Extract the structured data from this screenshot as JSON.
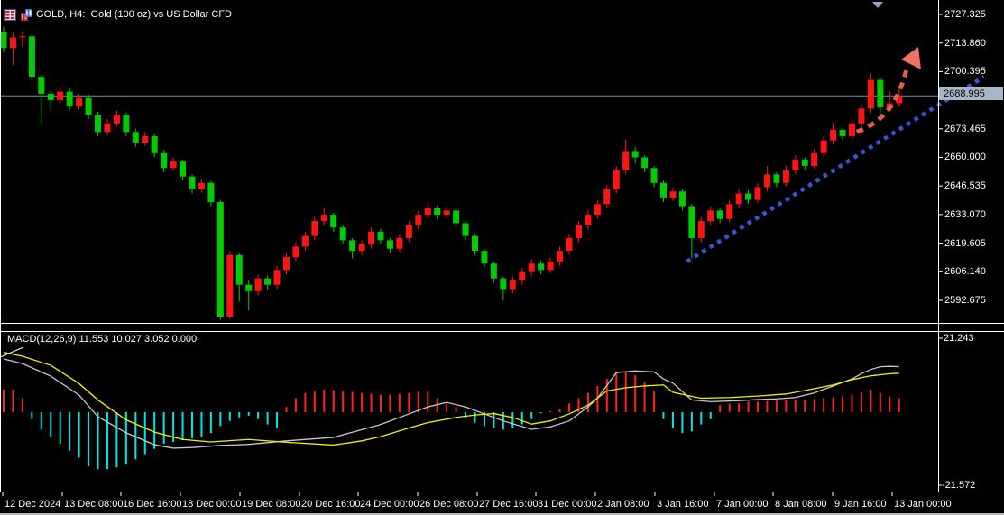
{
  "window": {
    "title": "GOLD, H4:  Gold (100 oz) vs US Dollar CFD",
    "icons": [
      "quote-table-icon",
      "chart-window-icon"
    ]
  },
  "colors": {
    "background": "#000000",
    "bull_candle": "#ff1414",
    "bear_candle": "#00cc00",
    "hist_positive": "#ff2020",
    "hist_negative": "#00e6e6",
    "macd_line": "#c8c8c8",
    "signal_line": "#f2f200",
    "current_price_line": "#7490ac",
    "badge_bg": "#a6b8c7",
    "trendline": "#3a55d4",
    "arrow": "#e25c50",
    "frame": "#ffffff"
  },
  "main_chart": {
    "price_labels": [
      "2727.325",
      "2713.860",
      "2700.395",
      "2673.465",
      "2660.000",
      "2646.535",
      "2633.070",
      "2619.605",
      "2606.140",
      "2592.675"
    ],
    "current_price_label": "2688.995",
    "scroll_marker": "down-triangle"
  },
  "macd_panel": {
    "indicator_label": "MACD(12,26,9) 11.553 10.027 3.052 0.000",
    "axis_top": "21.243",
    "axis_bottom": "-21.572"
  },
  "time_axis": {
    "labels": [
      "12 Dec 2024",
      "13 Dec 08:00",
      "16 Dec 16:00",
      "18 Dec 00:00",
      "19 Dec 08:00",
      "20 Dec 16:00",
      "24 Dec 00:00",
      "26 Dec 08:00",
      "27 Dec 16:00",
      "31 Dec 00:00",
      "2 Jan 08:00",
      "3 Jan 16:00",
      "7 Jan 00:00",
      "8 Jan 08:00",
      "9 Jan 16:00",
      "13 Jan 00:00"
    ]
  },
  "chart_data": [
    {
      "type": "candlestick",
      "title": "GOLD, H4: Gold (100 oz) vs US Dollar CFD",
      "symbol": "GOLD",
      "timeframe": "H4",
      "ylim": [
        2585,
        2727.325
      ],
      "y_tick_values": [
        2727.325,
        2713.86,
        2700.395,
        2673.465,
        2660.0,
        2646.535,
        2633.07,
        2619.605,
        2606.14,
        2592.675
      ],
      "current_price": 2688.995,
      "columns": [
        "open",
        "high",
        "low",
        "close"
      ],
      "candles": [
        [
          2719,
          2721.5,
          2709.5,
          2711.5
        ],
        [
          2711.5,
          2719,
          2703.5,
          2716.5
        ],
        [
          2716.5,
          2719.5,
          2712,
          2717
        ],
        [
          2717,
          2718,
          2696,
          2698
        ],
        [
          2698,
          2699,
          2676,
          2690
        ],
        [
          2690,
          2691.5,
          2682,
          2687
        ],
        [
          2687,
          2693,
          2685,
          2691
        ],
        [
          2691,
          2692.5,
          2682,
          2684
        ],
        [
          2684,
          2690,
          2682.5,
          2688
        ],
        [
          2688,
          2689.5,
          2678,
          2680
        ],
        [
          2680,
          2681.5,
          2670,
          2672
        ],
        [
          2672,
          2678,
          2670.5,
          2676
        ],
        [
          2676,
          2682,
          2674.5,
          2680
        ],
        [
          2680,
          2681,
          2670,
          2672
        ],
        [
          2672,
          2673.5,
          2665,
          2667
        ],
        [
          2667,
          2672,
          2665.5,
          2670
        ],
        [
          2670,
          2671,
          2660,
          2662
        ],
        [
          2662,
          2663.5,
          2653,
          2655
        ],
        [
          2655,
          2660,
          2653.5,
          2658
        ],
        [
          2658,
          2659,
          2649,
          2651
        ],
        [
          2651,
          2652,
          2643,
          2645
        ],
        [
          2645,
          2650,
          2643.5,
          2648
        ],
        [
          2648,
          2649,
          2637,
          2639
        ],
        [
          2639,
          2640,
          2583.5,
          2585
        ],
        [
          2585,
          2616,
          2584,
          2614
        ],
        [
          2614,
          2615,
          2592,
          2600
        ],
        [
          2600,
          2602,
          2588,
          2597
        ],
        [
          2597,
          2605,
          2595,
          2603
        ],
        [
          2603,
          2604.5,
          2597.5,
          2600
        ],
        [
          2600,
          2609,
          2598,
          2607
        ],
        [
          2607,
          2615,
          2605,
          2613
        ],
        [
          2613,
          2620,
          2611,
          2618
        ],
        [
          2618,
          2625,
          2616,
          2623
        ],
        [
          2623,
          2632,
          2621,
          2630
        ],
        [
          2630,
          2636,
          2628,
          2633
        ],
        [
          2633,
          2634,
          2625,
          2627
        ],
        [
          2627,
          2628,
          2619,
          2621
        ],
        [
          2621,
          2622,
          2612.5,
          2616
        ],
        [
          2616,
          2621,
          2614,
          2619
        ],
        [
          2619,
          2627,
          2617,
          2625
        ],
        [
          2625,
          2626.5,
          2619,
          2621
        ],
        [
          2621,
          2622,
          2615,
          2617
        ],
        [
          2617,
          2624,
          2615.5,
          2622
        ],
        [
          2622,
          2630,
          2620,
          2628
        ],
        [
          2628,
          2635,
          2626,
          2633
        ],
        [
          2633,
          2639,
          2631,
          2636
        ],
        [
          2636,
          2637.5,
          2631,
          2633
        ],
        [
          2633,
          2637,
          2631.5,
          2635
        ],
        [
          2635,
          2636,
          2627,
          2629
        ],
        [
          2629,
          2630,
          2621,
          2623
        ],
        [
          2623,
          2624,
          2614,
          2616
        ],
        [
          2616,
          2617,
          2608,
          2610
        ],
        [
          2610,
          2611,
          2601,
          2603
        ],
        [
          2603,
          2604,
          2592.5,
          2598
        ],
        [
          2598,
          2604,
          2596,
          2602
        ],
        [
          2602,
          2608,
          2600,
          2606
        ],
        [
          2606,
          2612,
          2604,
          2610
        ],
        [
          2610,
          2611.5,
          2605,
          2607
        ],
        [
          2607,
          2613,
          2605.5,
          2611
        ],
        [
          2611,
          2618,
          2609,
          2616
        ],
        [
          2616,
          2624,
          2614,
          2622
        ],
        [
          2622,
          2630,
          2620,
          2628
        ],
        [
          2628,
          2635,
          2626,
          2633
        ],
        [
          2633,
          2640,
          2631,
          2638
        ],
        [
          2638,
          2647,
          2636,
          2645
        ],
        [
          2645,
          2656,
          2643,
          2654
        ],
        [
          2654,
          2668.5,
          2652,
          2663
        ],
        [
          2663,
          2665,
          2657,
          2660
        ],
        [
          2660,
          2661,
          2653,
          2655
        ],
        [
          2655,
          2656,
          2646,
          2648
        ],
        [
          2648,
          2649,
          2639,
          2641
        ],
        [
          2641,
          2646,
          2639.5,
          2644
        ],
        [
          2644,
          2645,
          2635,
          2637
        ],
        [
          2637,
          2638,
          2612.5,
          2622
        ],
        [
          2622,
          2632,
          2620,
          2630
        ],
        [
          2630,
          2637,
          2628,
          2635
        ],
        [
          2635,
          2636,
          2629,
          2631
        ],
        [
          2631,
          2640,
          2629.5,
          2638
        ],
        [
          2638,
          2645,
          2636,
          2643
        ],
        [
          2643,
          2644.5,
          2638,
          2640
        ],
        [
          2640,
          2648,
          2638.5,
          2646
        ],
        [
          2646,
          2656,
          2644,
          2652
        ],
        [
          2652,
          2653,
          2646,
          2648
        ],
        [
          2648,
          2656,
          2646.5,
          2654
        ],
        [
          2654,
          2661,
          2652,
          2659
        ],
        [
          2659,
          2660,
          2654,
          2656
        ],
        [
          2656,
          2664,
          2654.5,
          2662
        ],
        [
          2662,
          2670,
          2660,
          2668
        ],
        [
          2668,
          2676.5,
          2666,
          2673
        ],
        [
          2673,
          2674,
          2668,
          2670
        ],
        [
          2670,
          2678,
          2668.5,
          2676
        ],
        [
          2676,
          2685,
          2674,
          2683
        ],
        [
          2683,
          2699.5,
          2681,
          2696.5
        ],
        [
          2696.5,
          2698,
          2679,
          2683.5
        ],
        [
          2683.5,
          2691,
          2682,
          2685.5
        ],
        [
          2685.5,
          2694,
          2683.5,
          2689
        ]
      ],
      "annotations": {
        "up_trendline": {
          "style": "dotted",
          "color": "#3a55d4",
          "start": {
            "i": 72.5,
            "price": 2611
          },
          "end": {
            "i": 104,
            "price": 2698
          }
        },
        "up_arrow": {
          "style": "dashed",
          "color": "#e25c50",
          "path_points": [
            {
              "i": 90.5,
              "price": 2672
            },
            {
              "i": 93.5,
              "price": 2677
            },
            {
              "i": 95,
              "price": 2686.5
            },
            {
              "i": 95.9,
              "price": 2703.5
            }
          ],
          "head": [
            [
              1018,
              52
            ],
            [
              999,
              66
            ],
            [
              1021,
              77
            ]
          ]
        }
      }
    },
    {
      "type": "macd",
      "label": "MACD(12,26,9) 11.553 10.027 3.052 0.000",
      "params": [
        12,
        26,
        9
      ],
      "values": [
        11.553,
        10.027,
        3.052,
        0.0
      ],
      "ylim": [
        -21.572,
        21.243
      ],
      "histogram": [
        6.5,
        6.5,
        4,
        -2,
        -5,
        -7,
        -9,
        -11,
        -13,
        -15.5,
        -16.3,
        -16.3,
        -15.8,
        -15,
        -13.5,
        -12,
        -10.5,
        -9,
        -8.5,
        -8,
        -7.5,
        -7,
        -6,
        -4,
        -2.5,
        -1.5,
        -1,
        -2,
        -3.5,
        -4.5,
        1.5,
        4,
        5.5,
        6,
        6.5,
        6.3,
        6,
        5.8,
        5.5,
        5.3,
        5,
        5,
        5.2,
        5.5,
        6,
        6,
        4,
        2.5,
        1.5,
        -1.5,
        -3,
        -4,
        -4.5,
        -5,
        -4.5,
        -3.5,
        -2,
        -0.3,
        0.3,
        1,
        2.5,
        4,
        5.5,
        7.5,
        9.5,
        11,
        11.6,
        10.5,
        8.5,
        6,
        -2,
        -4.5,
        -6,
        -5.5,
        -3.5,
        -2,
        2,
        2.5,
        2.5,
        3,
        3,
        3.2,
        3.3,
        3.5,
        3.5,
        3.6,
        3.8,
        4,
        4.2,
        4.5,
        5,
        5.7,
        6.5,
        5.5,
        4.5,
        4
      ],
      "macd_line_points": [
        [
          0,
          15.2
        ],
        [
          2,
          13.9
        ],
        [
          5,
          10.3
        ],
        [
          8,
          4.9
        ],
        [
          10,
          -1.3
        ],
        [
          13,
          -5.9
        ],
        [
          16,
          -9.3
        ],
        [
          18,
          -10.3
        ],
        [
          20,
          -10.1
        ],
        [
          23,
          -9.5
        ],
        [
          26,
          -9.2
        ],
        [
          30,
          -8.2
        ],
        [
          35,
          -7.2
        ],
        [
          38,
          -5
        ],
        [
          40,
          -3.5
        ],
        [
          43,
          -0.5
        ],
        [
          45,
          1.5
        ],
        [
          47,
          2.8
        ],
        [
          49,
          1.5
        ],
        [
          51,
          -0.5
        ],
        [
          53,
          -2.5
        ],
        [
          56,
          -4.9
        ],
        [
          58,
          -4.2
        ],
        [
          60,
          -2.5
        ],
        [
          62,
          1.5
        ],
        [
          63,
          4
        ],
        [
          65,
          11.3
        ],
        [
          67,
          11.8
        ],
        [
          69,
          11.5
        ],
        [
          70,
          9.5
        ],
        [
          71,
          8.3
        ],
        [
          73,
          3.5
        ],
        [
          75,
          3.0
        ],
        [
          78,
          3.3
        ],
        [
          80,
          3.6
        ],
        [
          82,
          3.8
        ],
        [
          84,
          4.2
        ],
        [
          86,
          5.5
        ],
        [
          88,
          7.5
        ],
        [
          90,
          9.5
        ],
        [
          91,
          11
        ],
        [
          92,
          12.2
        ],
        [
          93,
          13
        ],
        [
          94,
          13.1
        ],
        [
          95,
          13.0
        ]
      ],
      "signal_line_points": [
        [
          0,
          17.1
        ],
        [
          2,
          16
        ],
        [
          5,
          13.4
        ],
        [
          8,
          8.2
        ],
        [
          10,
          3.5
        ],
        [
          13,
          -2.2
        ],
        [
          16,
          -5.7
        ],
        [
          19,
          -7.8
        ],
        [
          22,
          -8.5
        ],
        [
          26,
          -7.8
        ],
        [
          30,
          -8.6
        ],
        [
          35,
          -9.4
        ],
        [
          38,
          -8.2
        ],
        [
          40,
          -7
        ],
        [
          43,
          -4.5
        ],
        [
          45,
          -3
        ],
        [
          48,
          -1.5
        ],
        [
          50,
          -0.8
        ],
        [
          52,
          -0.4
        ],
        [
          54,
          -1.5
        ],
        [
          56,
          -3.4
        ],
        [
          58,
          -2.5
        ],
        [
          60,
          -0.5
        ],
        [
          62,
          2.0
        ],
        [
          64,
          6.1
        ],
        [
          66,
          7.0
        ],
        [
          68,
          7.5
        ],
        [
          70,
          7.8
        ],
        [
          71,
          5.7
        ],
        [
          73,
          4.5
        ],
        [
          74,
          4.0
        ],
        [
          77,
          4.2
        ],
        [
          80,
          4.6
        ],
        [
          83,
          5.2
        ],
        [
          85,
          6.2
        ],
        [
          88,
          7.8
        ],
        [
          90,
          9.3
        ],
        [
          92,
          10.4
        ],
        [
          94,
          11.0
        ],
        [
          95,
          11.1
        ]
      ]
    }
  ]
}
